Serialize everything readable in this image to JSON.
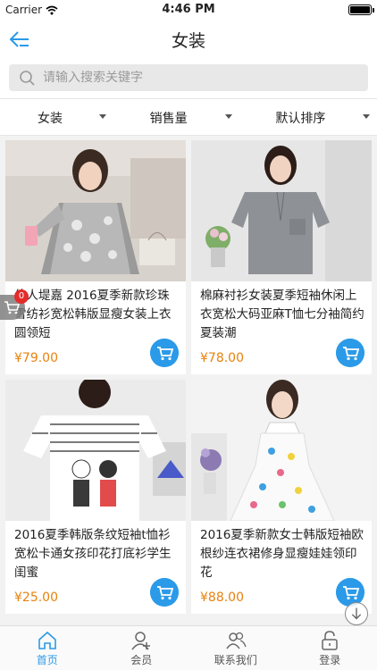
{
  "status_bar": {
    "carrier": "Carrier",
    "time": "4:46 PM"
  },
  "nav": {
    "title": "女装"
  },
  "search": {
    "placeholder": "请输入搜索关键字"
  },
  "filters": [
    {
      "label": "女装"
    },
    {
      "label": "销售量"
    },
    {
      "label": "默认排序"
    }
  ],
  "products": [
    {
      "name": "佳人堤嘉 2016夏季新款珍珠雪纺衫宽松韩版显瘦女装上衣圆领短",
      "price": "¥79.00"
    },
    {
      "name": "棉麻衬衫女装夏季短袖休闲上衣宽松大码亚麻T恤七分袖简约夏装潮",
      "price": "¥78.00"
    },
    {
      "name": "2016夏季韩版条纹短袖t恤衫宽松卡通女孩印花打底衫学生闺蜜",
      "price": "¥25.00"
    },
    {
      "name": "2016夏季新款女士韩版短袖欧根纱连衣裙修身显瘦娃娃领印花",
      "price": "¥88.00"
    }
  ],
  "cart": {
    "badge": "0"
  },
  "tabs": [
    {
      "label": "首页",
      "icon": "home-icon",
      "active": true
    },
    {
      "label": "会员",
      "icon": "member-icon",
      "active": false
    },
    {
      "label": "联系我们",
      "icon": "contact-icon",
      "active": false
    },
    {
      "label": "登录",
      "icon": "lock-icon",
      "active": false
    }
  ],
  "colors": {
    "accent": "#2b9ae8",
    "price": "#e8820e",
    "badge": "#e52a2a"
  }
}
